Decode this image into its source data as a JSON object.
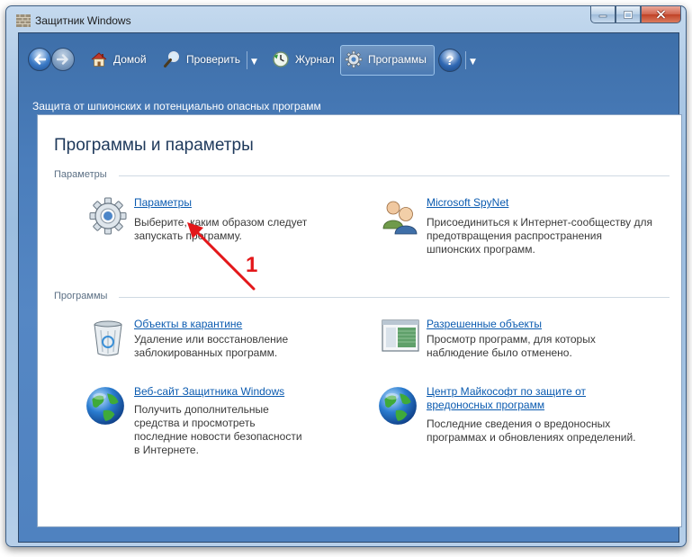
{
  "window": {
    "title": "Защитник Windows"
  },
  "toolbar": {
    "home_label": "Домой",
    "scan_label": "Проверить",
    "history_label": "Журнал",
    "tools_label": "Программы"
  },
  "subheader": "Защита от шпионских  и потенциально опасных программ",
  "page": {
    "title": "Программы и параметры",
    "sections": {
      "settings": "Параметры",
      "tools": "Программы"
    }
  },
  "items": {
    "options": {
      "link": "Параметры",
      "desc": [
        "Выберите, каким образом следует",
        "запускать программу."
      ]
    },
    "spynet": {
      "link": "Microsoft SpyNet",
      "desc": [
        "Присоединиться к Интернет-сообществу для",
        "предотвращения распространения",
        "шпионских программ."
      ]
    },
    "quarantine": {
      "link": "Объекты в карантине",
      "desc": [
        "Удаление или восстановление",
        "заблокированных программ."
      ]
    },
    "allowed": {
      "link": "Разрешенные объекты",
      "desc": [
        "Просмотр программ, для которых",
        "наблюдение было отменено."
      ]
    },
    "website": {
      "link": "Веб-сайт Защитника Windows",
      "desc": [
        "Получить дополнительные",
        "средства и просмотреть",
        "последние новости безопасности",
        "в Интернете."
      ]
    },
    "mmpc": {
      "link": [
        "Центр Майкософт по защите от",
        "вредоносных программ"
      ],
      "desc": [
        "Последние сведения о вредоносных",
        "программах и обновлениях определений."
      ]
    }
  },
  "annotation": {
    "number": "1"
  },
  "colors": {
    "link": "#0b5bb0",
    "annotation": "#e3171a"
  }
}
